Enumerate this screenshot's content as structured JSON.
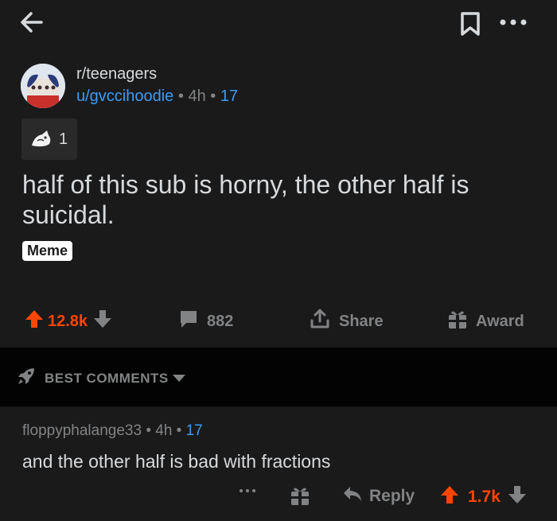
{
  "topbar": {
    "back_icon": "arrow-left-icon",
    "bookmark_icon": "bookmark-icon",
    "more_icon": "ellipsis-icon"
  },
  "post": {
    "subreddit": "r/teenagers",
    "author": "u/gvccihoodie",
    "separator": "•",
    "time": "4h",
    "award_count_meta": "17",
    "award_chip_count": "1",
    "title": "half of this sub is horny, the other half is suicidal.",
    "flair": "Meme",
    "votes": "12.8k",
    "comments": "882",
    "share_label": "Share",
    "award_label": "Award"
  },
  "sort": {
    "label": "BEST COMMENTS"
  },
  "comment": {
    "author": "floppyphalange33",
    "separator": "•",
    "time": "4h",
    "award_count": "17",
    "body": "and the other half is bad with fractions",
    "reply_label": "Reply",
    "votes": "1.7k"
  },
  "colors": {
    "background": "#1a1a1b",
    "upvote": "#ff4500",
    "link": "#3d9bf2",
    "muted": "#818384",
    "band": "#030303"
  }
}
